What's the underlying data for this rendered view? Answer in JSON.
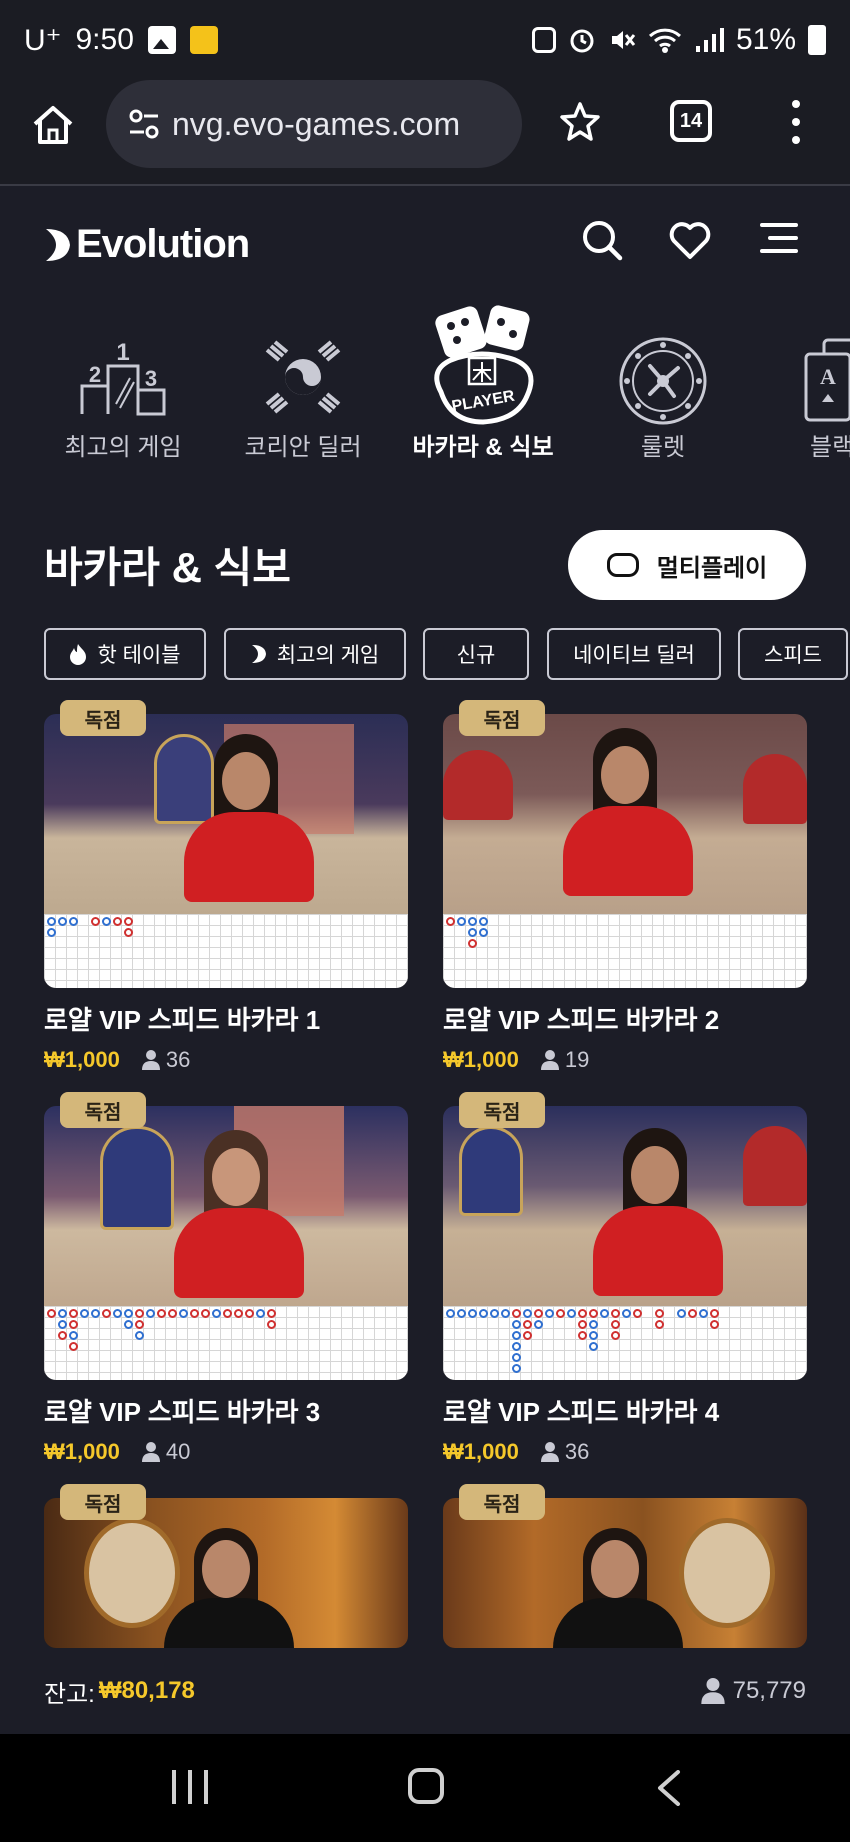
{
  "status_bar": {
    "carrier": "U⁺",
    "time": "9:50",
    "battery": "51%"
  },
  "browser": {
    "url": "nvg.evo-games.com",
    "tab_count": "14"
  },
  "site": {
    "brand": "Evolution"
  },
  "categories": [
    {
      "label": "최고의 게임",
      "active": false
    },
    {
      "label": "코리안 딜러",
      "active": false
    },
    {
      "label": "바카라 & 식보",
      "active": true,
      "icon_text": "PLAYER"
    },
    {
      "label": "룰렛",
      "active": false
    },
    {
      "label": "블랙",
      "active": false,
      "icon_text": "A"
    }
  ],
  "section": {
    "title": "바카라 & 식보",
    "multiplay_label": "멀티플레이"
  },
  "filters": [
    {
      "label": "핫 테이블",
      "icon": "flame-icon"
    },
    {
      "label": "최고의 게임",
      "icon": "evolution-mark-icon"
    },
    {
      "label": "신규"
    },
    {
      "label": "네이티브 딜러"
    },
    {
      "label": "스피드"
    }
  ],
  "games": [
    {
      "badge": "독점",
      "title": "로얄 VIP 스피드 바카라 1",
      "price": "₩1,000",
      "players": "36"
    },
    {
      "badge": "독점",
      "title": "로얄 VIP 스피드 바카라 2",
      "price": "₩1,000",
      "players": "19"
    },
    {
      "badge": "독점",
      "title": "로얄 VIP 스피드 바카라 3",
      "price": "₩1,000",
      "players": "40"
    },
    {
      "badge": "독점",
      "title": "로얄 VIP 스피드 바카라 4",
      "price": "₩1,000",
      "players": "36"
    },
    {
      "badge": "독점"
    },
    {
      "badge": "독점"
    }
  ],
  "footer": {
    "balance_label": "잔고:",
    "balance_value": "₩80,178",
    "online_count": "75,779"
  },
  "colors": {
    "background": "#1c1d27",
    "accent_gold": "#f5c82b",
    "badge": "#d4b77a",
    "chip_border": "#c9cad4"
  }
}
